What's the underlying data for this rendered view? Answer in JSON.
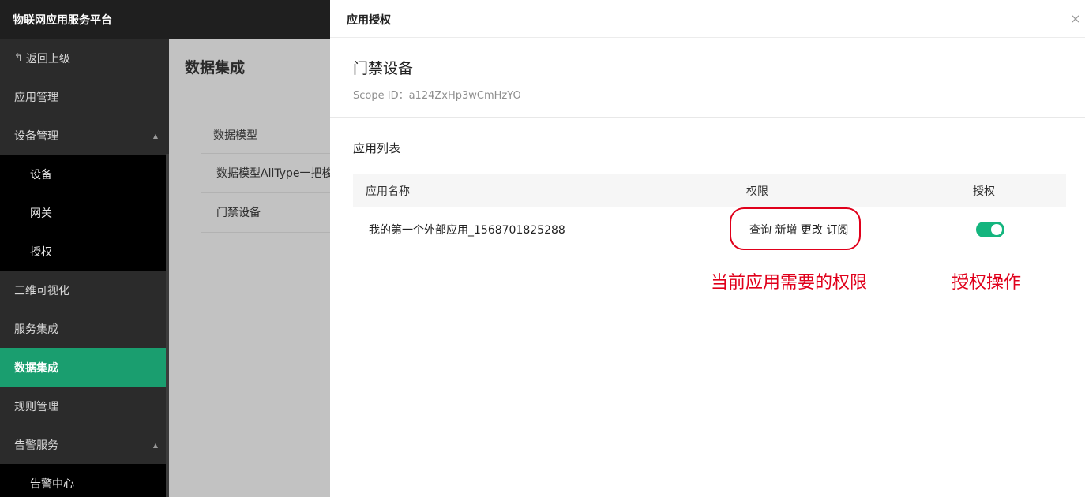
{
  "header": {
    "brand": "物联网应用服务平台"
  },
  "sidebar": {
    "back": "返回上级",
    "items": [
      {
        "label": "应用管理"
      },
      {
        "label": "设备管理"
      },
      {
        "label": "设备"
      },
      {
        "label": "网关"
      },
      {
        "label": "授权"
      },
      {
        "label": "三维可视化"
      },
      {
        "label": "服务集成"
      },
      {
        "label": "数据集成"
      },
      {
        "label": "规则管理"
      },
      {
        "label": "告警服务"
      },
      {
        "label": "告警中心"
      }
    ]
  },
  "content": {
    "title": "数据集成",
    "table_header": "数据模型",
    "rows": [
      "数据模型AllType一把梭",
      "门禁设备"
    ]
  },
  "drawer": {
    "title": "应用授权",
    "device_name": "门禁设备",
    "scope": "Scope ID：a124ZxHp3wCmHzYO",
    "section_title": "应用列表",
    "columns": {
      "name": "应用名称",
      "permission": "权限",
      "auth": "授权"
    },
    "rows": [
      {
        "name": "我的第一个外部应用_1568701825288",
        "permissions": "查询 新增 更改 订阅",
        "authorized": true
      }
    ]
  },
  "annotations": {
    "permissions_note": "当前应用需要的权限",
    "auth_note": "授权操作"
  },
  "colors": {
    "sidebar_active": "#1a9e6f",
    "toggle_on": "#14b57e",
    "annotation_red": "#e0001b"
  }
}
